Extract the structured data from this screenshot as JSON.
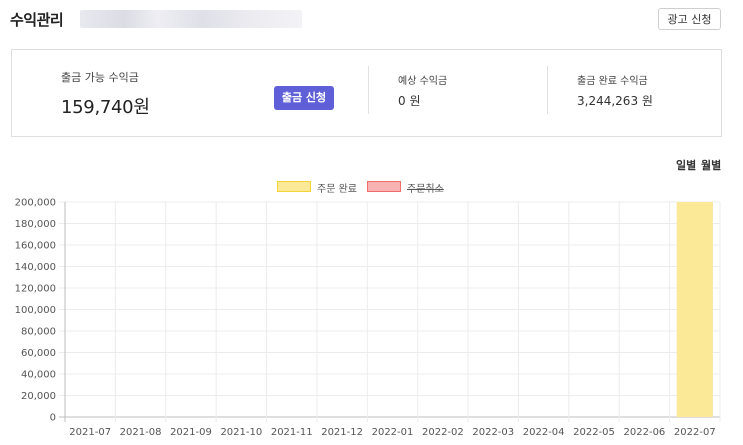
{
  "header": {
    "title": "수익관리",
    "ad_button": "광고 신청"
  },
  "summary": {
    "available_label": "출금 가능 수익금",
    "available_value": "159,740원",
    "withdraw_button": "출금 신청",
    "expected_label": "예상 수익금",
    "expected_value": "0 원",
    "completed_label": "출금 완료 수익금",
    "completed_value": "3,244,263 원"
  },
  "view_toggle": {
    "daily": "일별",
    "monthly": "월별"
  },
  "colors": {
    "accent": "#5f5fd8",
    "order_complete": "#fbe998",
    "order_complete_border": "#f5d33a",
    "order_cancel": "#f8b2b2",
    "order_cancel_border": "#ee6e6e"
  },
  "chart_data": {
    "type": "bar",
    "categories": [
      "2021-07",
      "2021-08",
      "2021-09",
      "2021-10",
      "2021-11",
      "2021-12",
      "2022-01",
      "2022-02",
      "2022-03",
      "2022-04",
      "2022-05",
      "2022-06",
      "2022-07"
    ],
    "series": [
      {
        "name": "주문 완료",
        "values": [
          0,
          0,
          0,
          0,
          0,
          0,
          0,
          0,
          0,
          0,
          0,
          0,
          200000
        ]
      },
      {
        "name": "주문취소",
        "values": [
          0,
          0,
          0,
          0,
          0,
          0,
          0,
          0,
          0,
          0,
          0,
          0,
          0
        ]
      }
    ],
    "y_ticks": [
      "0",
      "20,000",
      "40,000",
      "60,000",
      "80,000",
      "100,000",
      "120,000",
      "140,000",
      "160,000",
      "180,000",
      "200,000"
    ],
    "ylim": [
      0,
      200000
    ],
    "grid": true,
    "legend_position": "top-center"
  }
}
